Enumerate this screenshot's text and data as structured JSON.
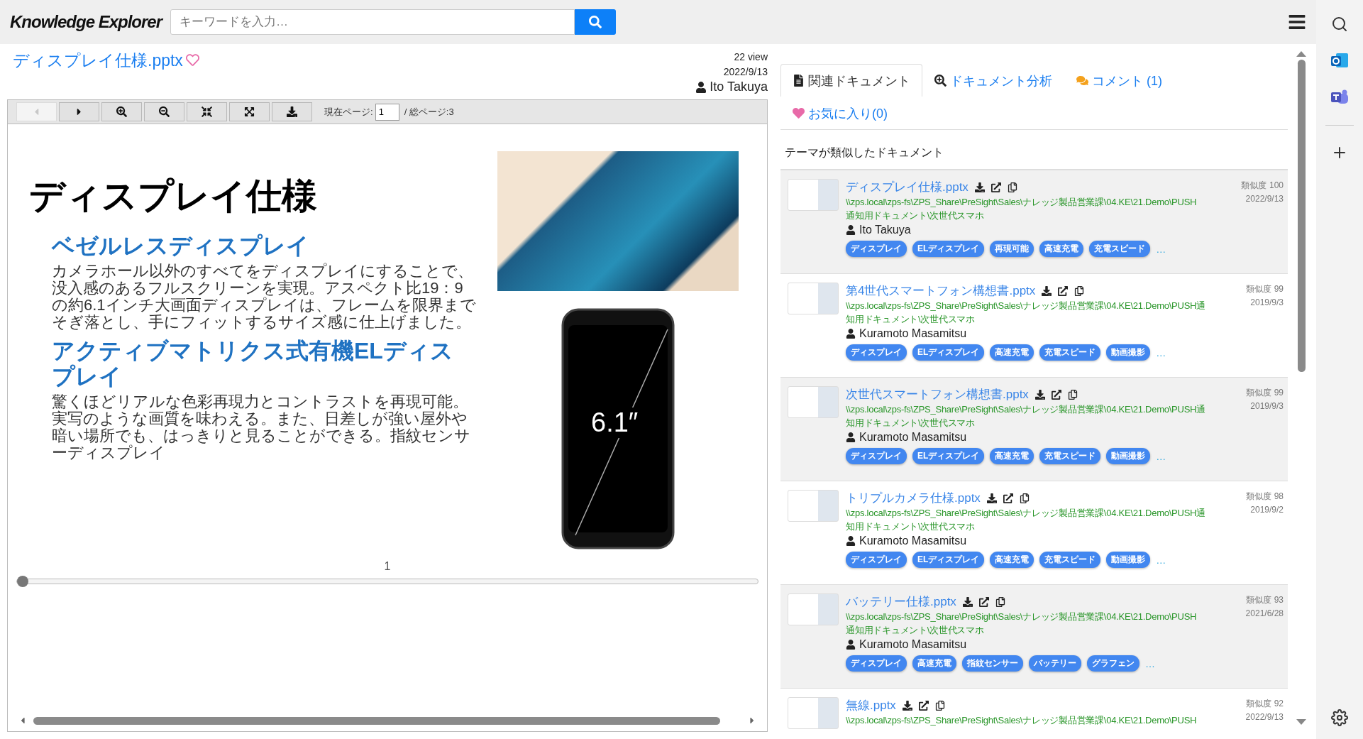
{
  "header": {
    "logo": "Knowledge Explorer",
    "search": {
      "placeholder": "キーワードを入力…"
    }
  },
  "document": {
    "title": "ディスプレイ仕様.pptx",
    "favorite": false,
    "views": "22 view",
    "date": "2022/9/13",
    "author": "Ito Takuya"
  },
  "toolbar": {
    "buttons": [
      {
        "kind": "prev",
        "disabled": true
      },
      {
        "kind": "next",
        "disabled": false
      },
      {
        "kind": "zoom-in",
        "disabled": false
      },
      {
        "kind": "zoom-out",
        "disabled": false
      },
      {
        "kind": "fit",
        "disabled": false
      },
      {
        "kind": "fullscreen",
        "disabled": false
      },
      {
        "kind": "download",
        "disabled": false
      }
    ],
    "page_label": "現在ページ:",
    "page": "1",
    "total": "/ 総ページ:3"
  },
  "slide": {
    "title": "ディスプレイ仕様",
    "sections": [
      {
        "heading": "ベゼルレスディスプレイ",
        "body": "カメラホール以外のすべてをディスプレイにすることで、没入感のあるフルスクリーンを実現。アスペクト比19：9の約6.1インチ大画面ディスプレイは、フレームを限界までそぎ落とし、手にフィットするサイズ感に仕上げました。"
      },
      {
        "heading": "アクティブマトリクス式有機ELディスプレイ",
        "body": "驚くほどリアルな色彩再現力とコントラストを再現可能。実写のような画質を味わえる。また、日差しが強い屋外や暗い場所でも、はっきりと見ることができる。指紋センサーディスプレイ"
      }
    ],
    "screen_size": "6.1″",
    "page_number": "1"
  },
  "page_slider": {
    "level": 0
  },
  "tabs": [
    {
      "label": "関連ドキュメント",
      "kind": "file",
      "selected": true
    },
    {
      "label": "ドキュメント分析",
      "kind": "analysis",
      "selected": false
    },
    {
      "label": "コメント (1)",
      "kind": "comments",
      "selected": false
    },
    {
      "label": "お気に入り(0)",
      "kind": "heart",
      "selected": false
    }
  ],
  "similar": {
    "title": "テーマが類似したドキュメント",
    "items": [
      {
        "title": "ディスプレイ仕様.pptx",
        "path": [
          "\\\\zps.local\\zps-fs\\ZPS_Share\\PreSight\\Sales\\ナレッジ製品営業課\\04.KE\\21.Demo\\PUSH",
          "通知用ドキュメント\\次世代スマホ"
        ],
        "author": "Ito Takuya",
        "score_label": "類似度",
        "score": "100",
        "date": "2022/9/13",
        "tags": [
          "ディスプレイ",
          "ELディスプレイ",
          "再現可能",
          "高速充電",
          "充電スピード"
        ],
        "more": "…"
      },
      {
        "title": "第4世代スマートフォン構想書.pptx",
        "path": [
          "\\\\zps.local\\zps-fs\\ZPS_Share\\PreSight\\Sales\\ナレッジ製品営業課\\04.KE\\21.Demo\\PUSH通",
          "知用ドキュメント\\次世代スマホ"
        ],
        "author": "Kuramoto Masamitsu",
        "score_label": "類似度",
        "score": "99",
        "date": "2019/9/3",
        "tags": [
          "ディスプレイ",
          "ELディスプレイ",
          "高速充電",
          "充電スピード",
          "動画撮影"
        ],
        "more": "…"
      },
      {
        "title": "次世代スマートフォン構想書.pptx",
        "path": [
          "\\\\zps.local\\zps-fs\\ZPS_Share\\PreSight\\Sales\\ナレッジ製品営業課\\04.KE\\21.Demo\\PUSH通",
          "知用ドキュメント\\次世代スマホ"
        ],
        "author": "Kuramoto Masamitsu",
        "score_label": "類似度",
        "score": "99",
        "date": "2019/9/3",
        "tags": [
          "ディスプレイ",
          "ELディスプレイ",
          "高速充電",
          "充電スピード",
          "動画撮影"
        ],
        "more": "…"
      },
      {
        "title": "トリプルカメラ仕様.pptx",
        "path": [
          "\\\\zps.local\\zps-fs\\ZPS_Share\\PreSight\\Sales\\ナレッジ製品営業課\\04.KE\\21.Demo\\PUSH通",
          "知用ドキュメント\\次世代スマホ"
        ],
        "author": "Kuramoto Masamitsu",
        "score_label": "類似度",
        "score": "98",
        "date": "2019/9/2",
        "tags": [
          "ディスプレイ",
          "ELディスプレイ",
          "高速充電",
          "充電スピード",
          "動画撮影"
        ],
        "more": "…"
      },
      {
        "title": "バッテリー仕様.pptx",
        "path": [
          "\\\\zps.local\\zps-fs\\ZPS_Share\\PreSight\\Sales\\ナレッジ製品営業課\\04.KE\\21.Demo\\PUSH",
          "通知用ドキュメント\\次世代スマホ"
        ],
        "author": "Kuramoto Masamitsu",
        "score_label": "類似度",
        "score": "93",
        "date": "2021/6/28",
        "tags": [
          "ディスプレイ",
          "高速充電",
          "指紋センサー",
          "バッテリー",
          "グラフェン"
        ],
        "more": "…"
      },
      {
        "title": "無線.pptx",
        "path": [
          "\\\\zps.local\\zps-fs\\ZPS_Share\\PreSight\\Sales\\ナレッジ製品営業課\\04.KE\\21.Demo\\PUSH"
        ],
        "score_label": "類似度",
        "score": "92",
        "date": "2022/9/13"
      }
    ]
  }
}
